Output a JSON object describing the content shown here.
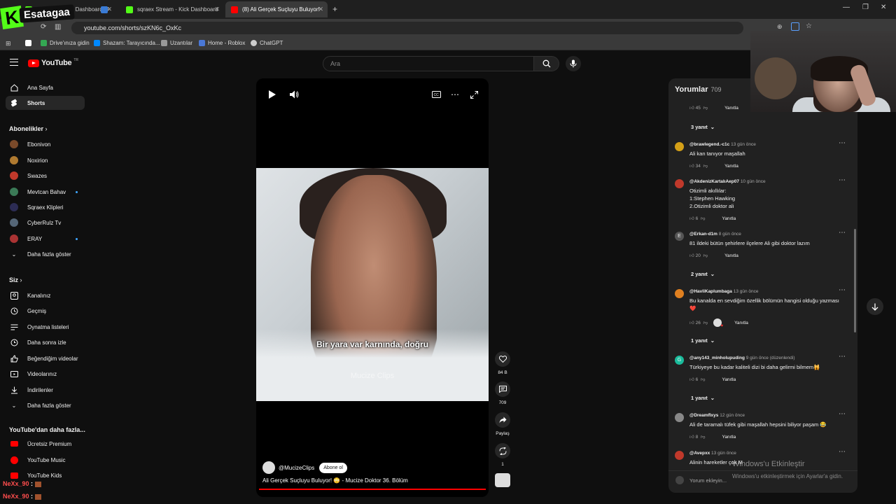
{
  "browser": {
    "tabs": [
      {
        "label": "Stream — Kick Dashboard",
        "color": "#53fc18"
      },
      {
        "label": "",
        "color": "#3a7bd5"
      },
      {
        "label": "sqraex Stream - Kick Dashboard",
        "color": "#53fc18"
      },
      {
        "label": "(8) Ali Gerçek Suçluyu Buluyor!",
        "color": "#ff0000"
      }
    ],
    "url": "youtube.com/shorts/szKN6c_OxKc",
    "bookmarks": [
      "Drive'ınıza gidin",
      "Shazam: Tarayıcında...",
      "Uzantılar",
      "Home - Roblox",
      "ChatGPT"
    ]
  },
  "overlay": {
    "logo_letter": "K",
    "streamer_name": "Esatagaa"
  },
  "youtube": {
    "logo": "YouTube",
    "logo_country": "TR",
    "search_placeholder": "Ara"
  },
  "sidebar": {
    "main": [
      "Ana Sayfa",
      "Shorts"
    ],
    "subs_header": "Abonelikler",
    "subs": [
      {
        "name": "Ebonivon",
        "color": "#7a4a2a",
        "live": false
      },
      {
        "name": "Noxirion",
        "color": "#b07a30",
        "live": false
      },
      {
        "name": "Swazes",
        "color": "#c0392b",
        "live": false
      },
      {
        "name": "Mevtcan Bahav",
        "color": "#3b7a57",
        "live": true
      },
      {
        "name": "Sqraex Klipleri",
        "color": "#2c2c54",
        "live": false
      },
      {
        "name": "CyberRulz Tv",
        "color": "#556677",
        "live": false
      },
      {
        "name": "ERAY",
        "color": "#a33",
        "live": true
      }
    ],
    "show_more": "Daha fazla göster",
    "you_header": "Siz",
    "you": [
      "Kanalınız",
      "Geçmiş",
      "Oynatma listeleri",
      "Daha sonra izle",
      "Beğendiğim videolar",
      "Videolarınız",
      "İndirilenler",
      "Daha fazla göster"
    ],
    "more_header": "YouTube'dan daha fazla...",
    "more": [
      "Ücretsiz Premium",
      "YouTube Music",
      "YouTube Kids"
    ]
  },
  "video": {
    "subtitle": "Bir yara var karnında, doğru",
    "watermark": "Mucize Clips",
    "channel": "@MucizeClips",
    "subscribe": "Abone ol",
    "title": "Ali Gerçek Suçluyu Buluyor! 😳 - Mucize Doktor 36. Bölüm",
    "progress": 1.0
  },
  "actions": {
    "likes": "84 B",
    "comments": "709",
    "share": "Paylaş",
    "remix": "1"
  },
  "comments": {
    "title": "Yorumlar",
    "count": "709",
    "reply_label": "Yanıtla",
    "items": [
      {
        "type": "actions",
        "likes": "45"
      },
      {
        "type": "thread",
        "label": "3 yanıt"
      },
      {
        "type": "comment",
        "user": "@brawlegend.-c1c",
        "time": "13 gün önce",
        "text": "Ali kan tanıyor maşallah",
        "likes": "34",
        "color": "#d4a017"
      },
      {
        "type": "comment",
        "user": "@AkdenizKartalıAep07",
        "time": "10 gün önce",
        "text": "Otizimli akıllılar:\n1:Stephen Hawking\n2.Otizimli doktor ali",
        "likes": "6",
        "color": "#c0392b"
      },
      {
        "type": "comment",
        "user": "@Erkan-d1m",
        "time": "8 gün önce",
        "text": "81 ildeki bütün şehirlere ilçelere Ali gibi doktor lazım",
        "likes": "20",
        "color": "#555",
        "initial": "E"
      },
      {
        "type": "thread",
        "label": "2 yanıt"
      },
      {
        "type": "comment",
        "user": "@HavliKaplumbaga",
        "time": "13 gün önce",
        "text": "Bu kanalda en sevdiğim özellik bölümün hangisi olduğu yazması\n❤️",
        "likes": "26",
        "color": "#e08020",
        "creator_heart": true
      },
      {
        "type": "thread",
        "label": "1 yanıt"
      },
      {
        "type": "comment",
        "user": "@any143_minholupuding",
        "time": "9 gün önce (düzenlendi)",
        "text": "Türkiyeye bu kadar kaliteli dizi bi daha gelirmi bilmem🙀",
        "likes": "6",
        "color": "#1abc9c",
        "initial": "G"
      },
      {
        "type": "thread",
        "label": "1 yanıt"
      },
      {
        "type": "comment",
        "user": "@Dreamflxys",
        "time": "12 gün önce",
        "text": "Ali de taramalı tüfek gibi maşallah hepsini biliyor paşam 😂",
        "likes": "8",
        "color": "#888"
      },
      {
        "type": "comment",
        "user": "@Avepxx",
        "time": "13 gün önce",
        "text": "Alinin hareketler çok M",
        "likes": "",
        "color": "#c0392b"
      }
    ],
    "input_placeholder": "Yorum ekleyin..."
  },
  "windows_watermark": {
    "title": "Windows'u Etkinleştir",
    "subtitle": "Windows'u etkinleştirmek için Ayarlar'a gidin."
  },
  "chat_overlay": [
    {
      "user": "NeXx_90",
      "sep": ":"
    },
    {
      "user": "NeXx_90",
      "sep": ":"
    }
  ]
}
